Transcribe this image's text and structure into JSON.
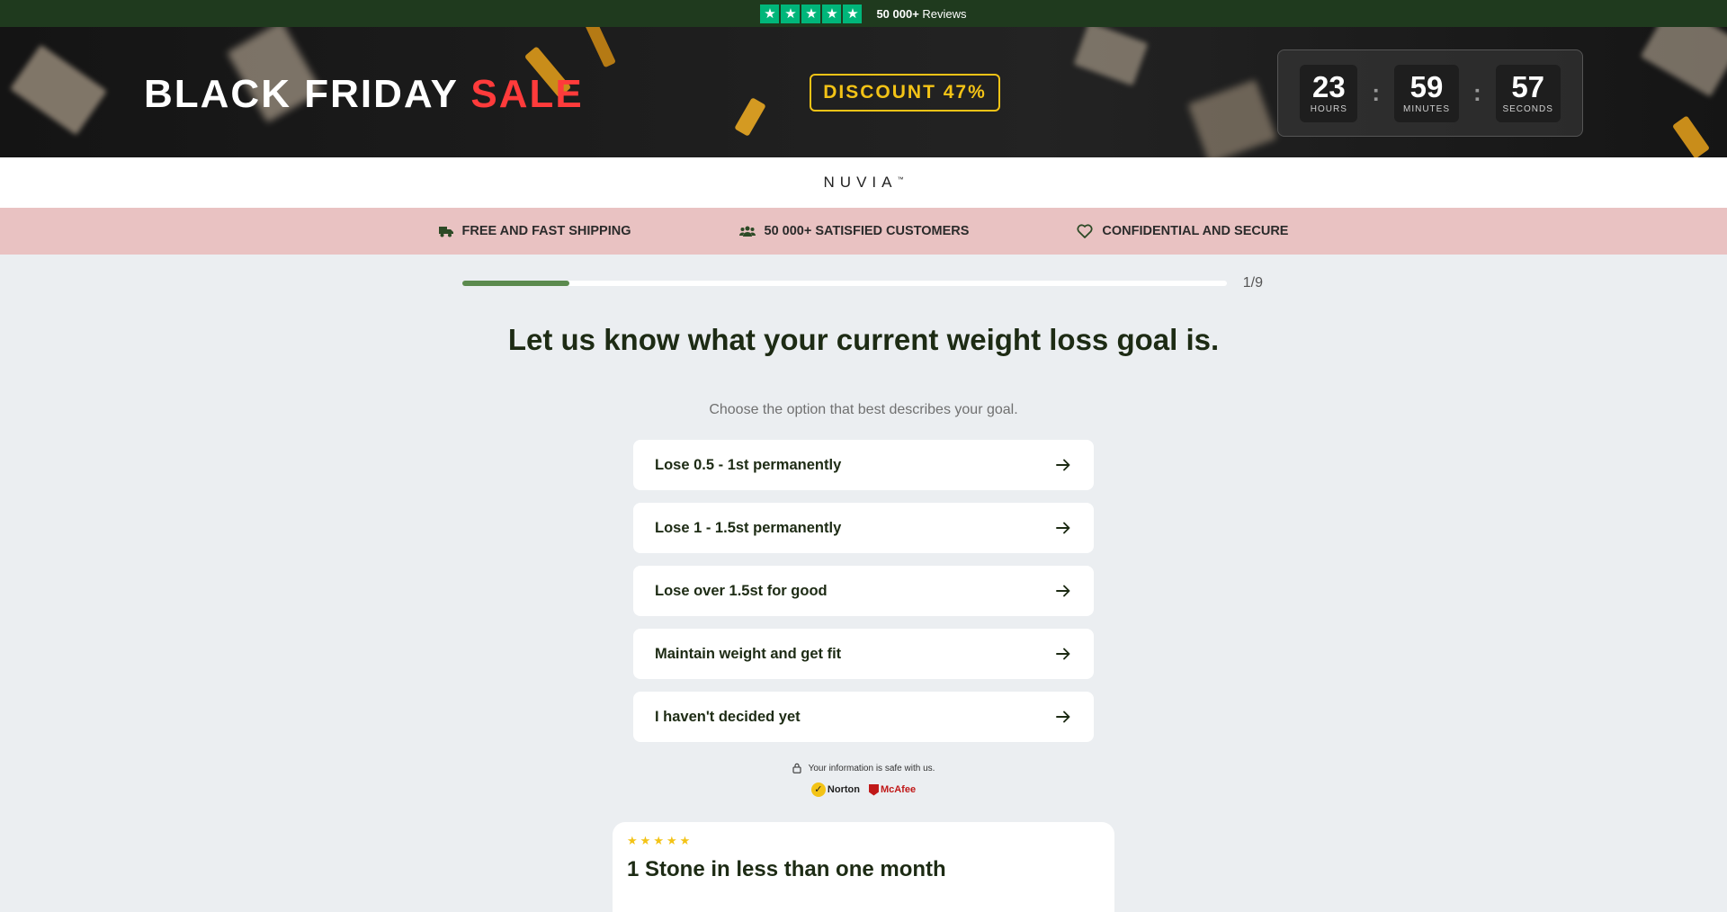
{
  "topbar": {
    "stars": [
      "★",
      "★",
      "★",
      "★",
      "★"
    ],
    "reviews_count": "50 000+",
    "reviews_label": "Reviews",
    "star_color": "#00b67a"
  },
  "banner": {
    "title_prefix": "BLACK FRIDAY",
    "title_highlight": "SALE",
    "discount": "DISCOUNT 47%",
    "timer": {
      "hours": "23",
      "hours_label": "HOURS",
      "minutes": "59",
      "minutes_label": "MINUTES",
      "seconds": "57",
      "seconds_label": "SECONDS",
      "separator": ":"
    }
  },
  "logo": {
    "text": "NUVIA",
    "mark": "™"
  },
  "trust": {
    "items": [
      {
        "icon": "truck-icon",
        "label": "FREE AND FAST SHIPPING"
      },
      {
        "icon": "users-icon",
        "label": "50 000+ SATISFIED CUSTOMERS"
      },
      {
        "icon": "heart-icon",
        "label": "CONFIDENTIAL AND SECURE"
      }
    ]
  },
  "progress": {
    "current": 1,
    "total": 9,
    "label": "1/9",
    "fraction": 0.14
  },
  "question": {
    "title": "Let us know what your current weight loss goal is.",
    "subtitle": "Choose the option that best describes your goal."
  },
  "options": [
    {
      "label": "Lose 0.5 - 1st permanently"
    },
    {
      "label": "Lose 1 - 1.5st permanently"
    },
    {
      "label": "Lose over 1.5st for good"
    },
    {
      "label": "Maintain weight and get fit"
    },
    {
      "label": "I haven't decided yet"
    }
  ],
  "security": {
    "text": "Your information is safe with us.",
    "badges": {
      "norton": "Norton",
      "mcafee": "McAfee"
    }
  },
  "review": {
    "stars": [
      "★",
      "★",
      "★",
      "★",
      "★"
    ],
    "title": "1 Stone in less than one month"
  },
  "colors": {
    "accent_green": "#5b8a4e",
    "heading": "#1d2b14",
    "sale_red": "#ff3b3b",
    "discount_gold": "#f3c316",
    "trust_bg": "#e9c2c2"
  }
}
